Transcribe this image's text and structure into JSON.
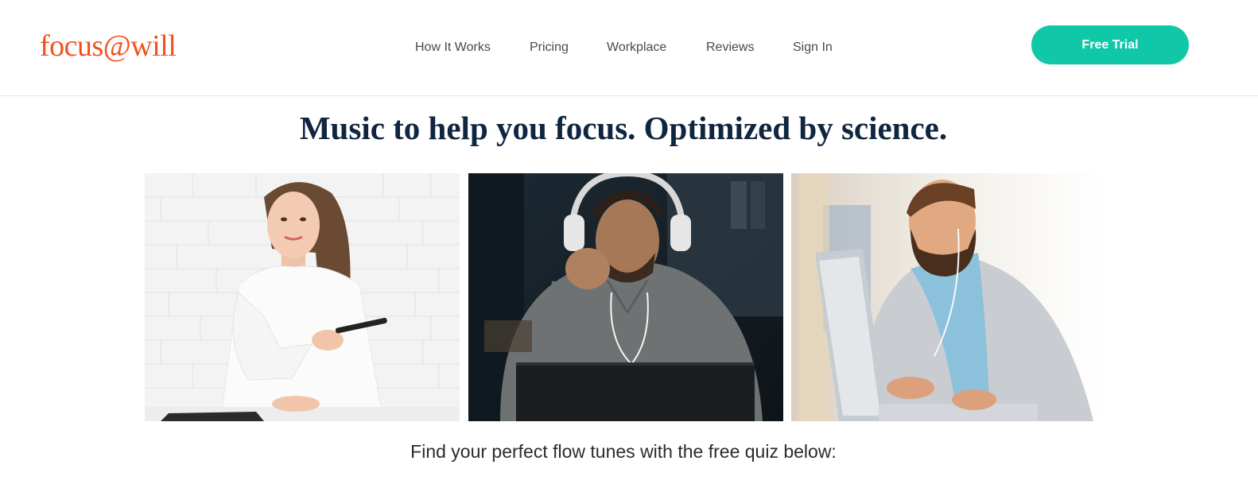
{
  "header": {
    "logo_text": "focus@will",
    "nav": [
      {
        "label": "How It Works"
      },
      {
        "label": "Pricing"
      },
      {
        "label": "Workplace"
      },
      {
        "label": "Reviews"
      },
      {
        "label": "Sign In"
      }
    ],
    "cta_label": "Free Trial"
  },
  "hero": {
    "headline": "Music to help you focus. Optimized by science.",
    "photos": [
      {
        "subject": "woman-holding-pen-photo"
      },
      {
        "subject": "man-with-headphones-at-laptop-photo"
      },
      {
        "subject": "bearded-man-typing-on-laptop-photo"
      }
    ],
    "subline": "Find your perfect flow tunes with the free quiz below:"
  },
  "colors": {
    "brand_orange": "#f0521f",
    "accent_teal": "#10c7a7",
    "headline_navy": "#10253f"
  }
}
